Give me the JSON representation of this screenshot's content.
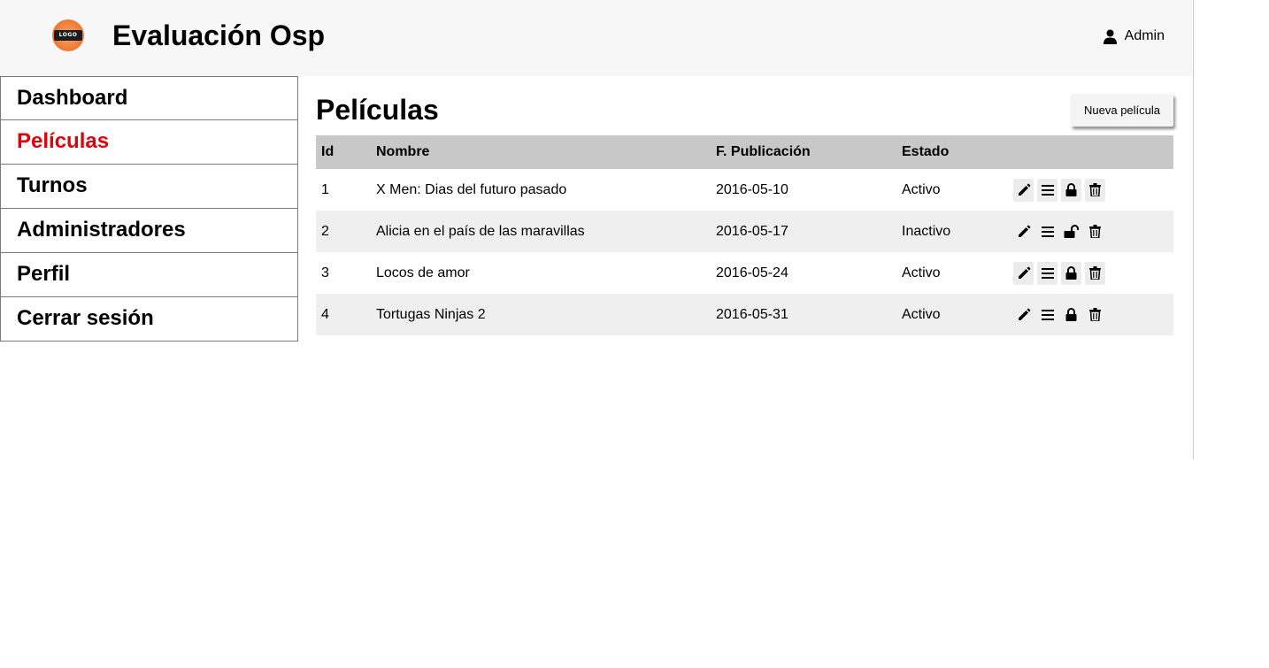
{
  "header": {
    "logo_text": "LOGO",
    "title": "Evaluación Osp",
    "user_label": "Admin"
  },
  "sidebar": {
    "items": [
      {
        "label": "Dashboard",
        "active": false
      },
      {
        "label": "Películas",
        "active": true
      },
      {
        "label": "Turnos",
        "active": false
      },
      {
        "label": "Administradores",
        "active": false
      },
      {
        "label": "Perfil",
        "active": false
      },
      {
        "label": "Cerrar sesión",
        "active": false
      }
    ]
  },
  "main": {
    "title": "Películas",
    "new_button": "Nueva película",
    "table": {
      "columns": [
        "Id",
        "Nombre",
        "F. Publicación",
        "Estado"
      ],
      "rows": [
        {
          "id": "1",
          "name": "X Men: Dias del futuro pasado",
          "date": "2016-05-10",
          "state": "Activo"
        },
        {
          "id": "2",
          "name": "Alicia en el país de las maravillas",
          "date": "2016-05-17",
          "state": "Inactivo"
        },
        {
          "id": "3",
          "name": "Locos de amor",
          "date": "2016-05-24",
          "state": "Activo"
        },
        {
          "id": "4",
          "name": "Tortugas Ninjas 2",
          "date": "2016-05-31",
          "state": "Activo"
        }
      ],
      "row_actions": [
        "pencil-icon",
        "list-icon",
        "lock-icon",
        "trash-icon"
      ]
    }
  },
  "colors": {
    "active_nav": "#e3000b",
    "header_bg": "#f7f7f7",
    "table_header_bg": "#c8c8c8",
    "row_alt_bg": "#efefef"
  }
}
